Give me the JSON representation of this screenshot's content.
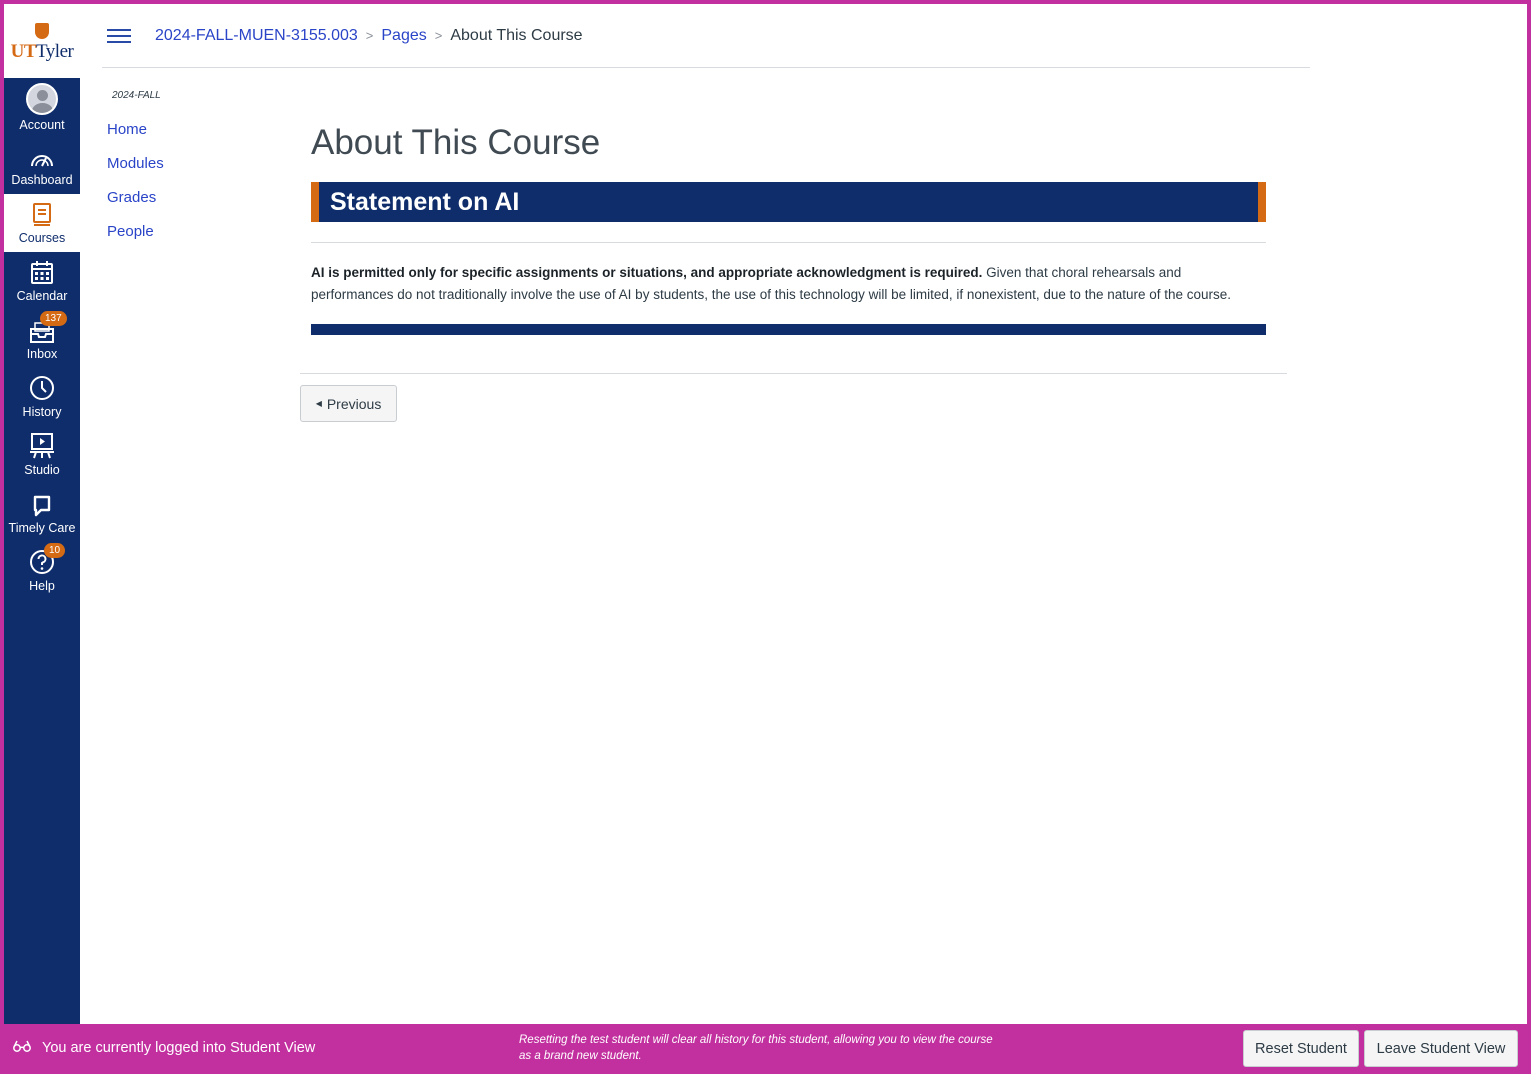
{
  "logo": {
    "prefix": "UT",
    "suffix": "Tyler"
  },
  "global_nav": {
    "items": [
      {
        "label": "Account",
        "icon": "avatar-icon"
      },
      {
        "label": "Dashboard",
        "icon": "dashboard-icon"
      },
      {
        "label": "Courses",
        "icon": "courses-icon",
        "active": true
      },
      {
        "label": "Calendar",
        "icon": "calendar-icon"
      },
      {
        "label": "Inbox",
        "icon": "inbox-icon",
        "badge": "137"
      },
      {
        "label": "History",
        "icon": "clock-icon"
      },
      {
        "label": "Studio",
        "icon": "studio-icon"
      },
      {
        "label": "Timely Care",
        "icon": "chat-icon"
      },
      {
        "label": "Help",
        "icon": "help-icon",
        "badge": "10"
      }
    ]
  },
  "breadcrumb": {
    "course": "2024-FALL-MUEN-3155.003",
    "section": "Pages",
    "current": "About This Course",
    "separator": ">"
  },
  "course_nav": {
    "term": "2024-FALL",
    "links": [
      "Home",
      "Modules",
      "Grades",
      "People"
    ]
  },
  "page": {
    "title": "About This Course",
    "section_heading": "Statement on AI",
    "body_bold": "AI is permitted only for specific assignments or situations, and appropriate acknowledgment is required.",
    "body_rest": " Given that choral rehearsals and performances do not traditionally involve the use of AI by students, the use of this technology will be limited, if nonexistent, due to the nature of the course.",
    "previous_label": "Previous"
  },
  "student_view": {
    "status": "You are currently logged into Student View",
    "note": "Resetting the test student will clear all history for this student, allowing you to view the course as a brand new student.",
    "reset_label": "Reset Student",
    "leave_label": "Leave Student View"
  },
  "colors": {
    "nav_bg": "#0f2d6b",
    "accent_orange": "#d56a15",
    "link_blue": "#2a44c8",
    "student_view_magenta": "#c2309f"
  }
}
